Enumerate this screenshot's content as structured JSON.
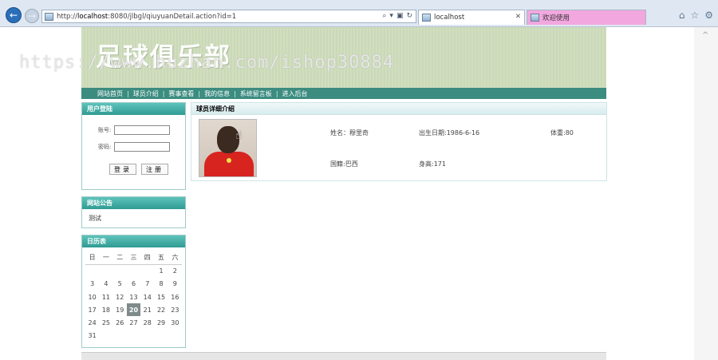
{
  "browser": {
    "url_prefix": "http://",
    "url_host": "localhost",
    "url_rest": ":8080/jlbgl/qiuyuanDetail.action?id=1",
    "tabs": [
      {
        "label": "localhost"
      },
      {
        "label": "欢迎使用"
      }
    ],
    "tab_close": "✕"
  },
  "site": {
    "banner_title": "足球俱乐部",
    "watermark": "https://www.huzhan.com/ishop30884",
    "menu": [
      "网站首页",
      "球员介绍",
      "赛事查看",
      "我的信息",
      "系统留言板",
      "进入后台"
    ]
  },
  "login": {
    "title": "用户登陆",
    "account_label": "账号:",
    "password_label": "密码:",
    "login_button": "登录",
    "register_button": "注册"
  },
  "notice": {
    "title": "网站公告",
    "text": "测试"
  },
  "calendar": {
    "title": "日历表",
    "weekdays": [
      "日",
      "一",
      "二",
      "三",
      "四",
      "五",
      "六"
    ],
    "weeks": [
      [
        "",
        "",
        "",
        "",
        "",
        "1",
        "2"
      ],
      [
        "3",
        "4",
        "5",
        "6",
        "7",
        "8",
        "9"
      ],
      [
        "10",
        "11",
        "12",
        "13",
        "14",
        "15",
        "16"
      ],
      [
        "17",
        "18",
        "19",
        "20",
        "21",
        "22",
        "23"
      ],
      [
        "24",
        "25",
        "26",
        "27",
        "28",
        "29",
        "30"
      ],
      [
        "31",
        "",
        "",
        "",
        "",
        "",
        ""
      ]
    ],
    "today": "20"
  },
  "detail": {
    "title": "球员详细介绍",
    "name": "姓名：穆里奇",
    "birth": "出生日期:1986-6-16",
    "weight": "体重:80",
    "nationality": "国籍:巴西",
    "height": "身高:171"
  }
}
